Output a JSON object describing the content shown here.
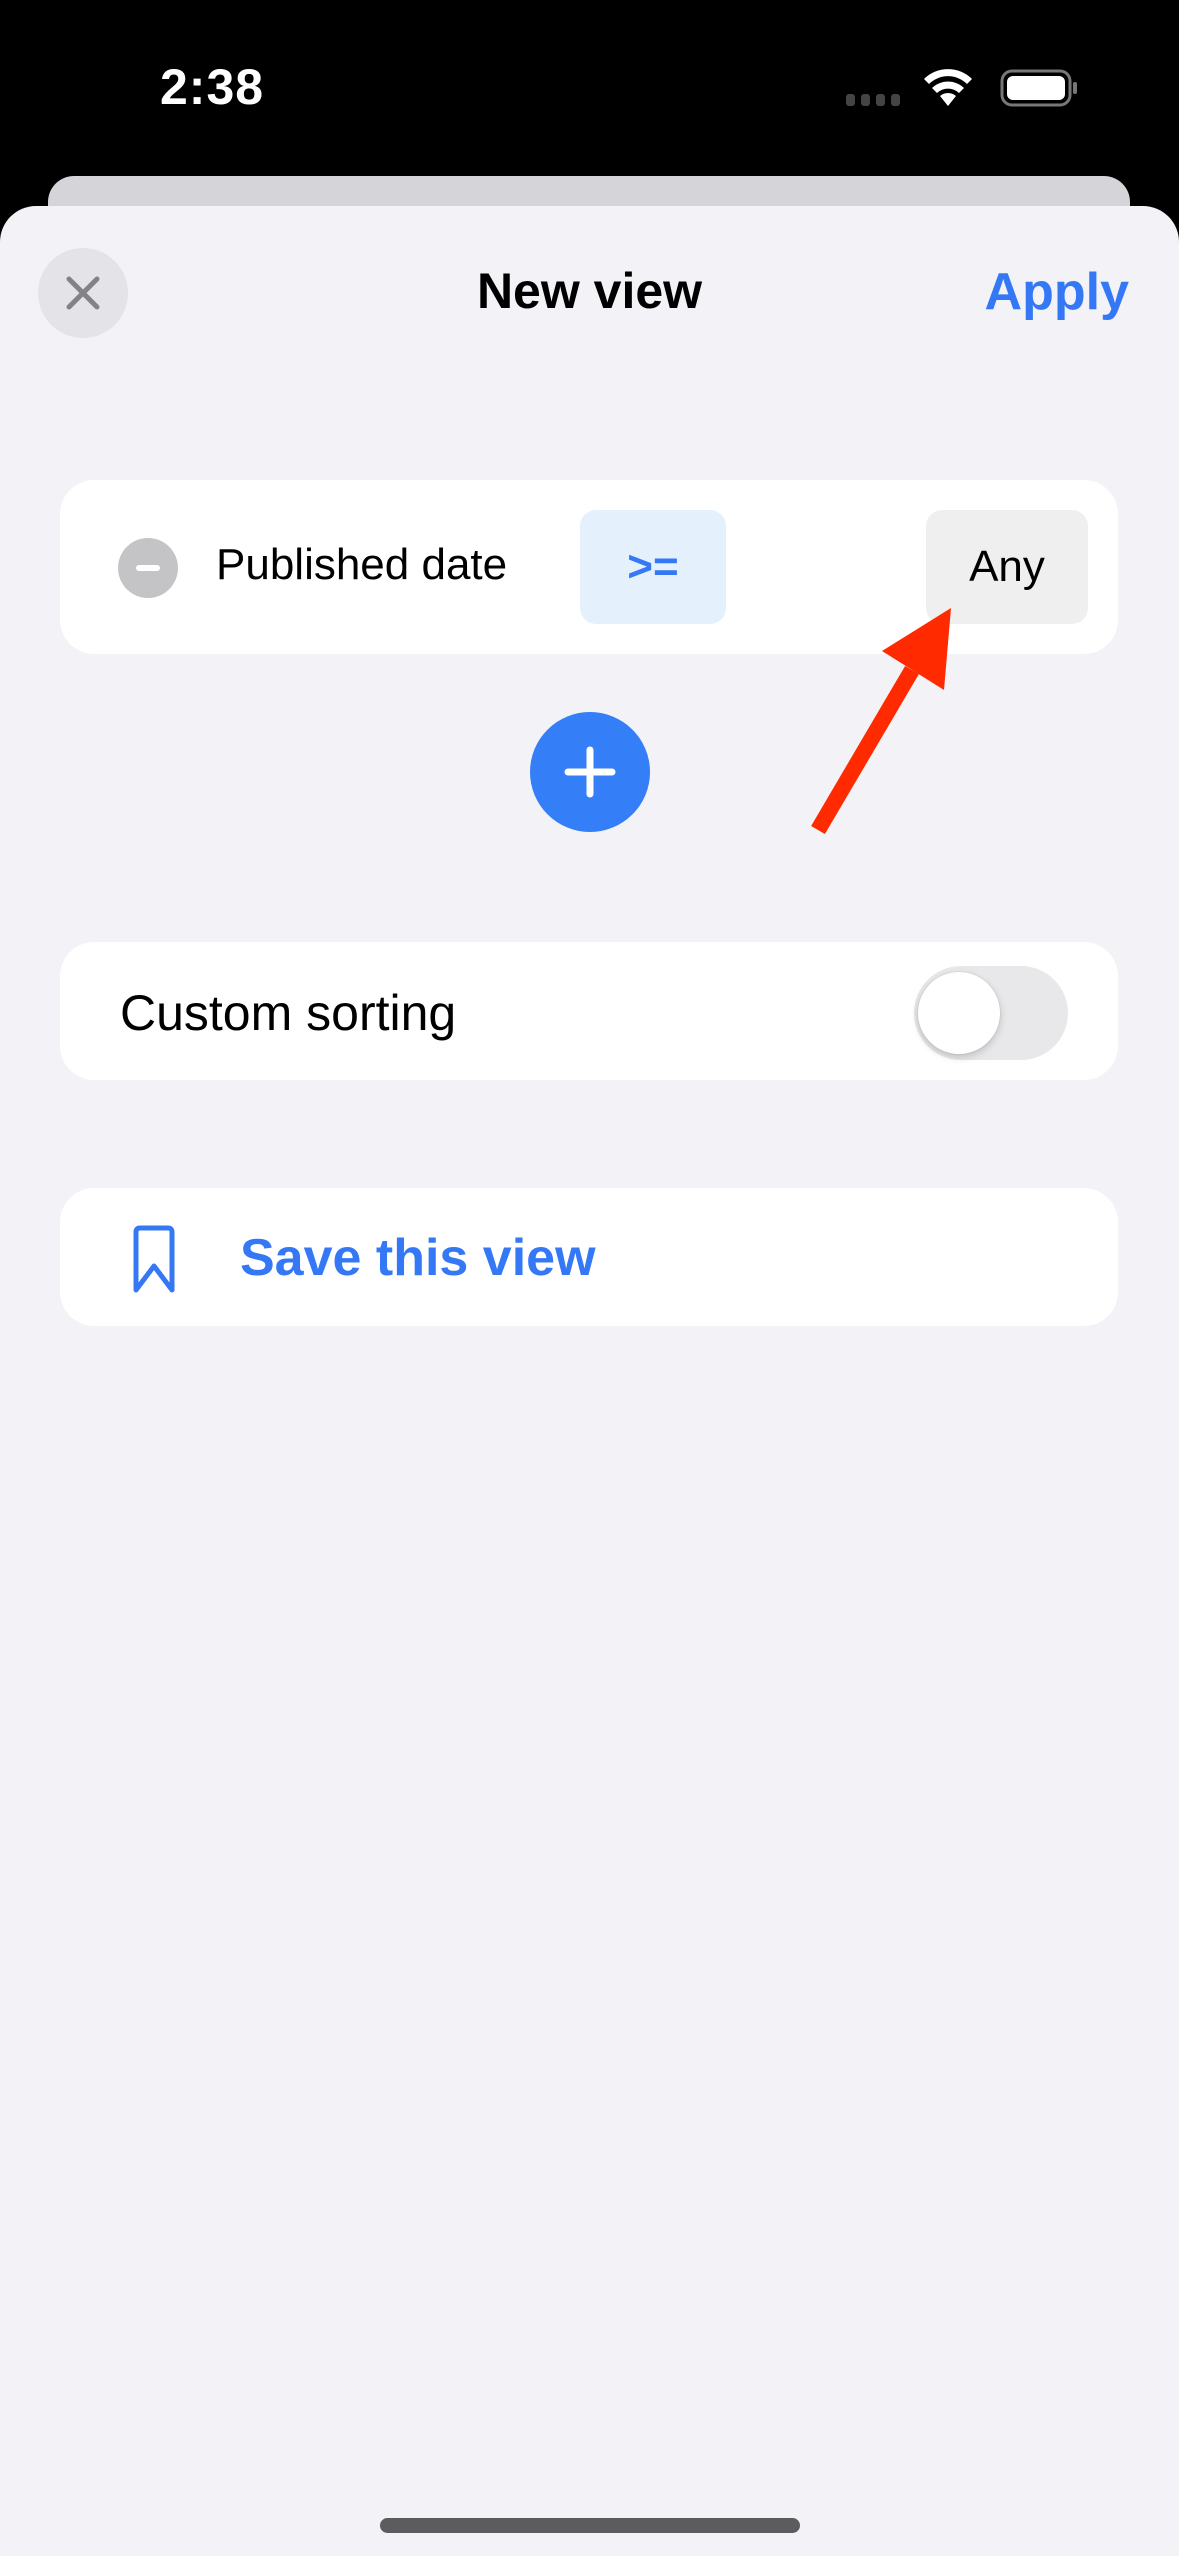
{
  "status_bar": {
    "time": "2:38",
    "icons": [
      "cellular-signal-icon",
      "wifi-icon",
      "battery-icon"
    ]
  },
  "nav": {
    "title": "New view",
    "close_icon": "close-icon",
    "apply_label": "Apply"
  },
  "filter": {
    "remove_icon": "minus-circle-icon",
    "field": "Published date",
    "operator": ">=",
    "value": "Any"
  },
  "add_filter": {
    "icon": "plus-icon"
  },
  "custom_sorting": {
    "label": "Custom sorting",
    "enabled": false
  },
  "save_view": {
    "icon": "bookmark-icon",
    "label": "Save this view"
  },
  "annotation": {
    "type": "arrow",
    "target": "filter-value-button",
    "color": "#ff2a00"
  },
  "colors": {
    "accent": "#3478f6",
    "sheet_background": "#f2f2f7",
    "card_background": "#ffffff",
    "operator_chip_background": "#e4f1fd",
    "value_chip_background": "#efefef"
  }
}
